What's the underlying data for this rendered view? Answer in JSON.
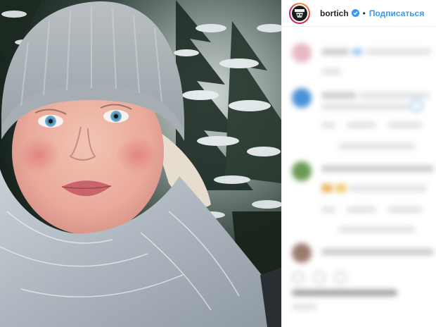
{
  "post": {
    "username": "bortich",
    "separator": "•",
    "follow_label": "Подписаться",
    "verified": true
  },
  "icons": {
    "avatar": "profile-avatar",
    "verified": "verified-badge-icon",
    "comment_icons": [
      "heart-icon",
      "comment-icon",
      "share-icon"
    ]
  },
  "colors": {
    "accent": "#3897f0",
    "text": "#262626",
    "divider": "#efefef"
  }
}
